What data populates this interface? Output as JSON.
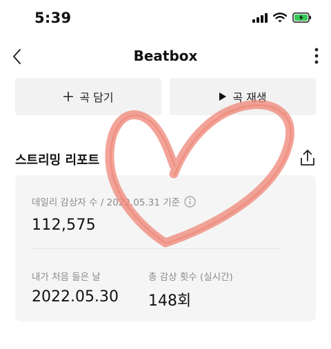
{
  "status_bar": {
    "time": "5:39",
    "battery_color": "#34c759"
  },
  "navbar": {
    "title": "Beatbox"
  },
  "actions": {
    "add_label": "곡 담기",
    "play_label": "곡 재생"
  },
  "report": {
    "title": "스트리밍 리포트",
    "daily_label": "데일리 감상자 수 / 2022.05.31 기준",
    "daily_value": "112,575",
    "first_listen_label": "내가 처음 들은 날",
    "first_listen_value": "2022.05.30",
    "total_plays_label": "총 감상 횟수 (실시간)",
    "total_plays_value": "148회"
  },
  "drawing": {
    "shape": "heart",
    "color": "#f08b7c"
  }
}
